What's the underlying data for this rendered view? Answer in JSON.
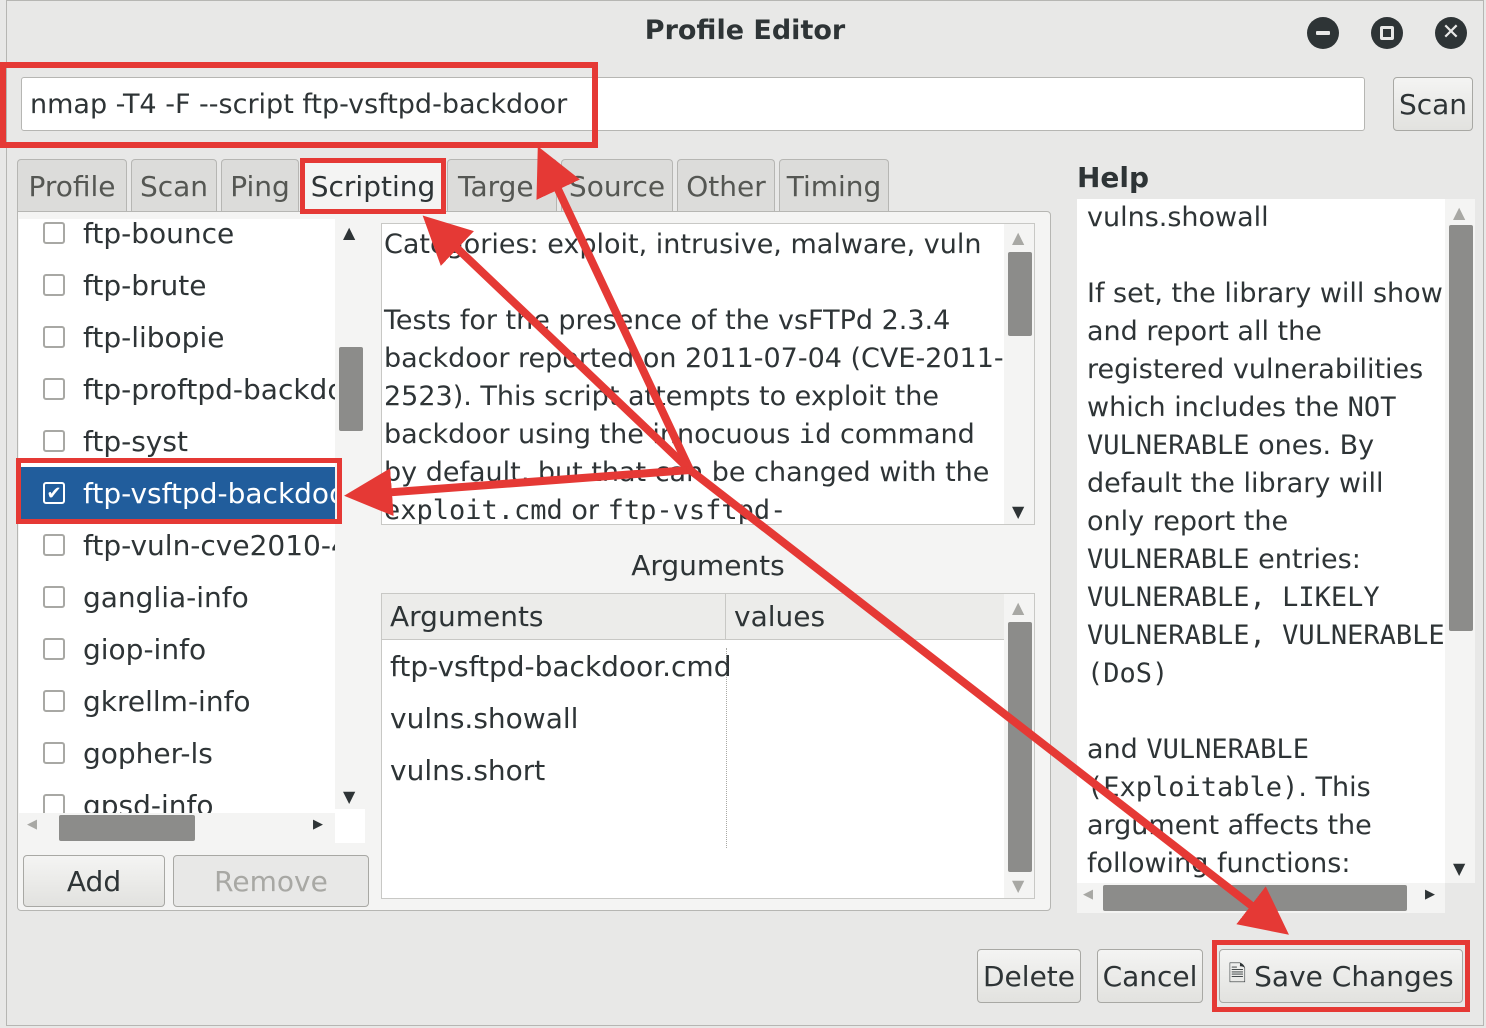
{
  "window": {
    "title": "Profile Editor"
  },
  "command": {
    "value": "nmap -T4 -F --script ftp-vsftpd-backdoor",
    "scan_label": "Scan"
  },
  "tabs": [
    {
      "label": "Profile"
    },
    {
      "label": "Scan"
    },
    {
      "label": "Ping"
    },
    {
      "label": "Scripting"
    },
    {
      "label": "Targe"
    },
    {
      "label": "Source"
    },
    {
      "label": "Other"
    },
    {
      "label": "Timing"
    }
  ],
  "scripts": [
    {
      "label": "ftp-bounce",
      "checked": false
    },
    {
      "label": "ftp-brute",
      "checked": false
    },
    {
      "label": "ftp-libopie",
      "checked": false
    },
    {
      "label": "ftp-proftpd-backdo",
      "checked": false
    },
    {
      "label": "ftp-syst",
      "checked": false
    },
    {
      "label": "ftp-vsftpd-backdoo",
      "checked": true
    },
    {
      "label": "ftp-vuln-cve2010-4",
      "checked": false
    },
    {
      "label": "ganglia-info",
      "checked": false
    },
    {
      "label": "giop-info",
      "checked": false
    },
    {
      "label": "gkrellm-info",
      "checked": false
    },
    {
      "label": "gopher-ls",
      "checked": false
    },
    {
      "label": "gpsd-info",
      "checked": false
    }
  ],
  "list_buttons": {
    "add": "Add",
    "remove": "Remove"
  },
  "description": {
    "categories": "Categories: exploit, intrusive, malware, vuln",
    "body_1": "Tests for the presence of the vsFTPd 2.3.4 backdoor reported on 2011-07-04 (CVE-2011-2523). This script attempts to exploit the backdoor using the innocuous ",
    "code_1": "id",
    "body_2": " command by default, but that can be changed with the ",
    "code_2": "exploit.cmd",
    "body_3": " or ",
    "code_3": "ftp-vsftpd-"
  },
  "arguments": {
    "title": "Arguments",
    "col_arguments": "Arguments",
    "col_values": "values",
    "rows": [
      {
        "name": "ftp-vsftpd-backdoor.cmd",
        "value": ""
      },
      {
        "name": "vulns.showall",
        "value": ""
      },
      {
        "name": "vulns.short",
        "value": ""
      }
    ]
  },
  "help": {
    "label": "Help",
    "heading": "vulns.showall",
    "p1_a": "If set, the library will show and report all the registered vulnerabilities which includes the ",
    "p1_code1": "NOT VULNERABLE",
    "p1_b": " ones. By default the library will only report the ",
    "p1_code2": "VULNERABLE",
    "p1_c": " entries: ",
    "p1_code3": "VULNERABLE, LIKELY VULNERABLE, VULNERABLE (DoS)",
    "p2_a": "and ",
    "p2_code1": "VULNERABLE (Exploitable)",
    "p2_b": ". This argument affects the following functions: vulns.Report.make_output()"
  },
  "footer": {
    "delete": "Delete",
    "cancel": "Cancel",
    "save": "Save Changes"
  },
  "colors": {
    "highlight_red": "#e53935",
    "selection_blue": "#215d9c"
  }
}
